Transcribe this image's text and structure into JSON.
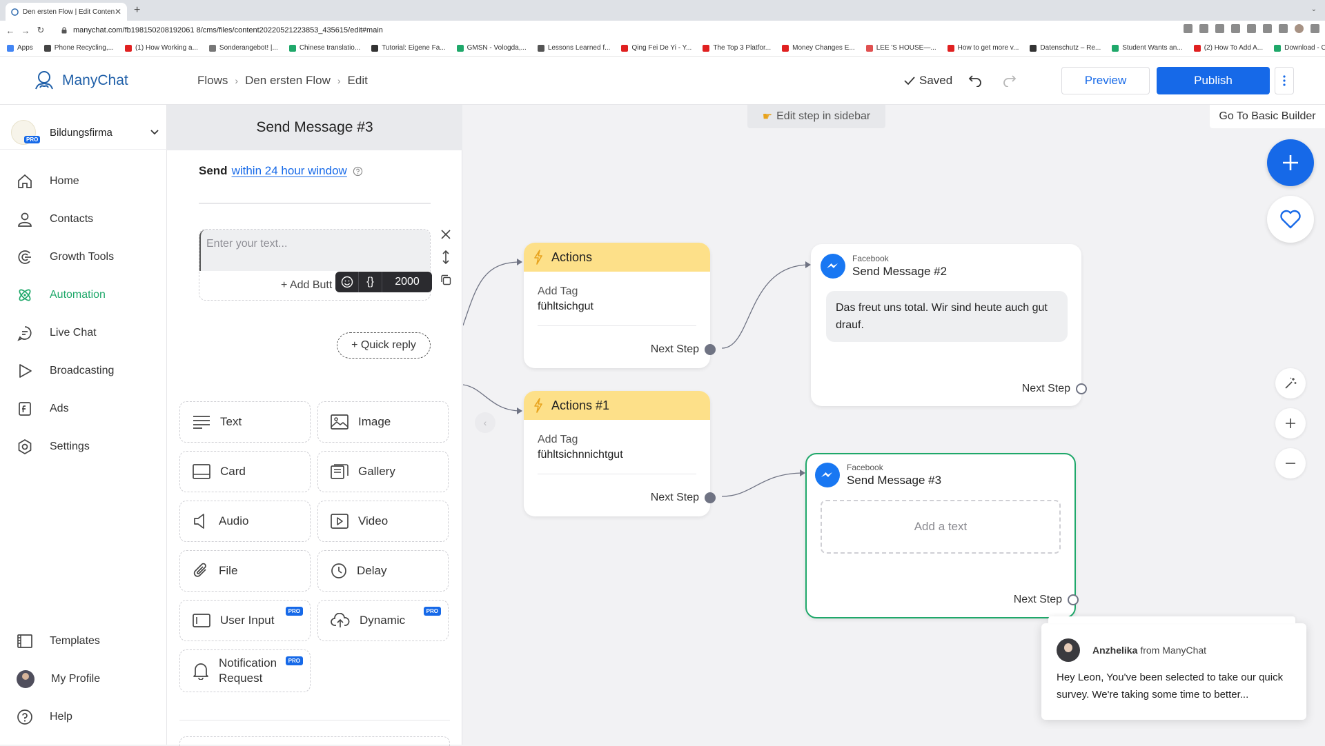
{
  "browser": {
    "tab_title": "Den ersten Flow | Edit Content",
    "url": "manychat.com/fb198150208192061 8/cms/files/content20220521223853_435615/edit#main",
    "bookmarks": [
      {
        "label": "Apps",
        "color": "#4285f4"
      },
      {
        "label": "Phone Recycling,...",
        "color": "#444444"
      },
      {
        "label": "(1) How Working a...",
        "color": "#e02020"
      },
      {
        "label": "Sonderangebot! |...",
        "color": "#777777"
      },
      {
        "label": "Chinese translatio...",
        "color": "#1fa86a"
      },
      {
        "label": "Tutorial: Eigene Fa...",
        "color": "#333333"
      },
      {
        "label": "GMSN - Vologda,...",
        "color": "#1fa86a"
      },
      {
        "label": "Lessons Learned f...",
        "color": "#555555"
      },
      {
        "label": "Qing Fei De Yi - Y...",
        "color": "#e02020"
      },
      {
        "label": "The Top 3 Platfor...",
        "color": "#e02020"
      },
      {
        "label": "Money Changes E...",
        "color": "#e02020"
      },
      {
        "label": "LEE 'S HOUSE—...",
        "color": "#e05050"
      },
      {
        "label": "How to get more v...",
        "color": "#e02020"
      },
      {
        "label": "Datenschutz – Re...",
        "color": "#333333"
      },
      {
        "label": "Student Wants an...",
        "color": "#1fa86a"
      },
      {
        "label": "(2) How To Add A...",
        "color": "#e02020"
      },
      {
        "label": "Download - Cooki...",
        "color": "#1fa86a"
      }
    ]
  },
  "header": {
    "brand": "ManyChat",
    "breadcrumb": [
      "Flows",
      "Den ersten Flow",
      "Edit"
    ],
    "saved": "Saved",
    "preview": "Preview",
    "publish": "Publish",
    "accent": "#1669e8"
  },
  "sidebar": {
    "account": {
      "name": "Bildungsfirma",
      "badge": "PRO"
    },
    "items": [
      {
        "label": "Home",
        "icon": "home-icon"
      },
      {
        "label": "Contacts",
        "icon": "contacts-icon"
      },
      {
        "label": "Growth Tools",
        "icon": "growth-tools-icon"
      },
      {
        "label": "Automation",
        "icon": "automation-icon",
        "active": true
      },
      {
        "label": "Live Chat",
        "icon": "live-chat-icon"
      },
      {
        "label": "Broadcasting",
        "icon": "broadcasting-icon"
      },
      {
        "label": "Ads",
        "icon": "ads-icon"
      },
      {
        "label": "Settings",
        "icon": "settings-icon"
      }
    ],
    "bottom": [
      {
        "label": "Templates",
        "icon": "templates-icon"
      },
      {
        "label": "My Profile",
        "icon": "avatar"
      },
      {
        "label": "Help",
        "icon": "help-icon"
      }
    ],
    "active_color": "#1fa86a"
  },
  "editor": {
    "title": "Send Message #3",
    "send_prefix": "Send",
    "send_window": "within 24 hour window",
    "text_placeholder": "Enter your text...",
    "add_button": "+ Add Butt",
    "char_count": "2000",
    "quick_reply": "+ Quick reply",
    "blocks": [
      {
        "label": "Text",
        "icon": "text-icon"
      },
      {
        "label": "Image",
        "icon": "image-icon"
      },
      {
        "label": "Card",
        "icon": "card-icon"
      },
      {
        "label": "Gallery",
        "icon": "gallery-icon"
      },
      {
        "label": "Audio",
        "icon": "audio-icon"
      },
      {
        "label": "Video",
        "icon": "video-icon"
      },
      {
        "label": "File",
        "icon": "file-icon"
      },
      {
        "label": "Delay",
        "icon": "delay-icon"
      },
      {
        "label": "User Input",
        "icon": "user-input-icon",
        "pro": "PRO"
      },
      {
        "label": "Dynamic",
        "icon": "dynamic-icon",
        "pro": "PRO"
      },
      {
        "label": "Notification Request",
        "icon": "notification-icon",
        "pro": "PRO"
      }
    ]
  },
  "canvas": {
    "hint": "Edit step in sidebar",
    "basic_builder": "Go To Basic Builder",
    "actions": [
      {
        "title": "Actions",
        "label": "Add Tag",
        "value": "fühltsichgut",
        "next": "Next Step"
      },
      {
        "title": "Actions #1",
        "label": "Add Tag",
        "value": "fühltsichnnichtgut",
        "next": "Next Step"
      }
    ],
    "messages": [
      {
        "source": "Facebook",
        "title": "Send Message #2",
        "text": "Das freut uns total. Wir sind heute auch gut drauf.",
        "next": "Next Step"
      },
      {
        "source": "Facebook",
        "title": "Send Message #3",
        "placeholder": "Add a text",
        "next": "Next Step",
        "selected": true
      }
    ],
    "selected_color": "#1fa86a"
  },
  "chat": {
    "agent": "Anzhelika",
    "from": "from ManyChat",
    "message": "Hey Leon,  You've been selected to take our quick survey. We're taking some time to better..."
  }
}
